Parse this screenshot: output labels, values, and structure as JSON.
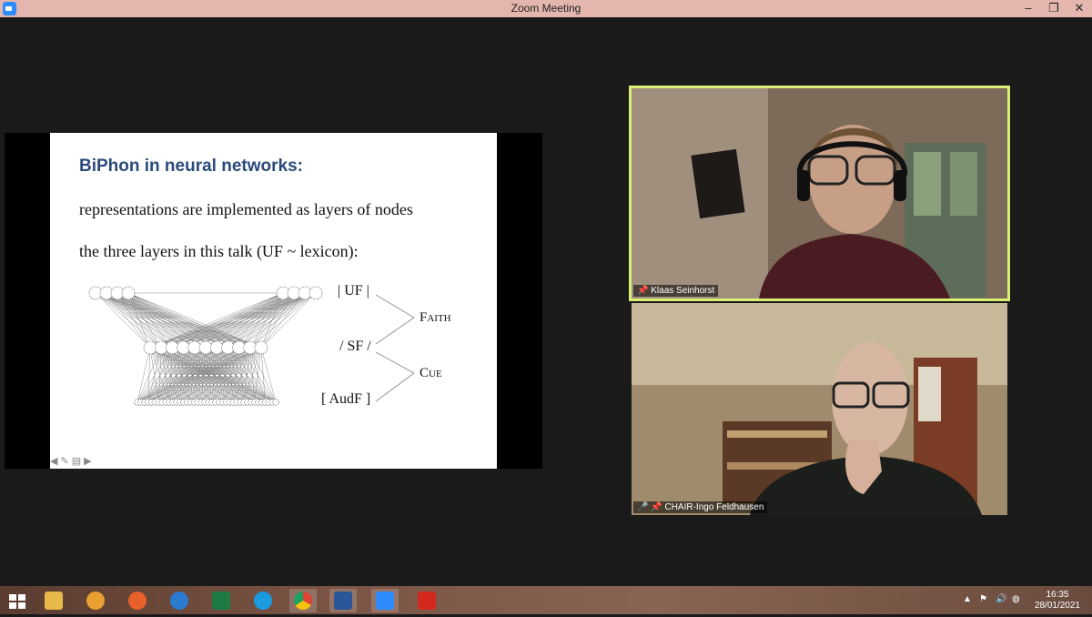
{
  "window": {
    "title": "Zoom Meeting"
  },
  "slide": {
    "title": "BiPhon in neural networks:",
    "line1": "representations are implemented as layers of nodes",
    "line2": "the three layers in this talk (UF ~ lexicon):",
    "labels": {
      "uf": "| UF |",
      "sf": "/ SF /",
      "audf": "[ AudF ]",
      "faith": "Faith",
      "cue": "Cue"
    }
  },
  "participants": [
    {
      "name": "Klaas Seinhorst",
      "active_speaker": true
    },
    {
      "name": "CHAIR-Ingo Feldhausen",
      "muted": true
    }
  ],
  "taskbar": {
    "apps": [
      "start-icon",
      "file-explorer-icon",
      "settings-icon",
      "firefox-icon",
      "edge-legacy-icon",
      "excel-icon",
      "edge-icon",
      "chrome-icon",
      "word-icon",
      "zoom-icon",
      "acrobat-icon"
    ],
    "time": "16:35",
    "date": "28/01/2021"
  },
  "colors": {
    "titlebar": "#e4b6ad",
    "slide_title": "#2b4a7a",
    "active_speaker_border": "#d8ef74"
  }
}
